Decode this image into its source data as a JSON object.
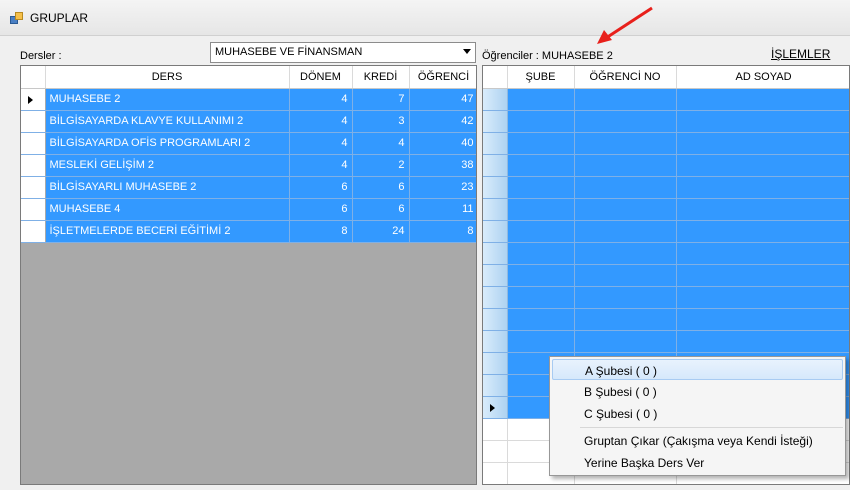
{
  "window": {
    "title": "GRUPLAR"
  },
  "labels": {
    "dersler": "Dersler :",
    "ogrenciler": "Öğrenciler : MUHASEBE 2",
    "islemler": "İŞLEMLER"
  },
  "combo": {
    "value": "MUHASEBE VE FİNANSMAN"
  },
  "courses": {
    "headers": [
      "DERS",
      "DÖNEM",
      "KREDİ",
      "ÖĞRENCİ"
    ],
    "rows": [
      [
        "MUHASEBE 2",
        "4",
        "7",
        "47"
      ],
      [
        "BİLGİSAYARDA KLAVYE KULLANIMI 2",
        "4",
        "3",
        "42"
      ],
      [
        "BİLGİSAYARDA OFİS PROGRAMLARI 2",
        "4",
        "4",
        "40"
      ],
      [
        "MESLEKİ GELİŞİM 2",
        "4",
        "2",
        "38"
      ],
      [
        "BİLGİSAYARLI MUHASEBE 2",
        "6",
        "6",
        "23"
      ],
      [
        "MUHASEBE 4",
        "6",
        "6",
        "11"
      ],
      [
        "İŞLETMELERDE BECERİ EĞİTİMİ 2",
        "8",
        "24",
        "8"
      ]
    ]
  },
  "students": {
    "headers": [
      "ŞUBE",
      "ÖĞRENCİ NO",
      "AD SOYAD"
    ],
    "rows": [
      [
        "",
        "",
        ""
      ],
      [
        "",
        "",
        ""
      ],
      [
        "",
        "",
        ""
      ],
      [
        "",
        "",
        ""
      ],
      [
        "",
        "",
        ""
      ],
      [
        "",
        "",
        ""
      ],
      [
        "",
        "",
        ""
      ],
      [
        "",
        "",
        ""
      ],
      [
        "",
        "",
        ""
      ],
      [
        "",
        "",
        ""
      ],
      [
        "",
        "",
        ""
      ],
      [
        "",
        "",
        ""
      ],
      [
        "",
        "",
        ""
      ],
      [
        "",
        "",
        ""
      ],
      [
        "",
        "",
        ""
      ]
    ]
  },
  "context_menu": {
    "items": [
      "A Şubesi ( 0 )",
      "B Şubesi ( 0 )",
      "C Şubesi ( 0 )",
      "Gruptan Çıkar (Çakışma veya Kendi İsteği)",
      "Yerine Başka Ders Ver"
    ]
  },
  "colors": {
    "selection": "#3399ff",
    "arrow": "#e8201b"
  }
}
